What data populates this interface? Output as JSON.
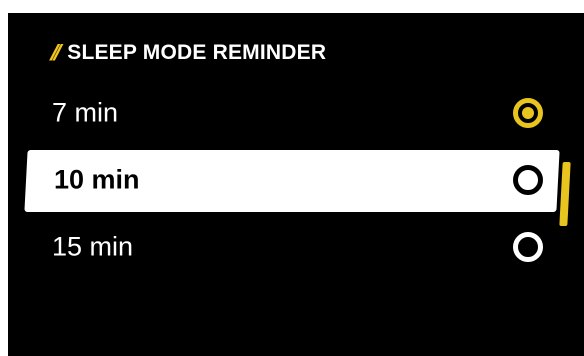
{
  "header": {
    "slashes": "//",
    "title": "SLEEP MODE REMINDER"
  },
  "options": [
    {
      "label": "7 min",
      "selected": true,
      "focused": false
    },
    {
      "label": "10 min",
      "selected": false,
      "focused": true
    },
    {
      "label": "15 min",
      "selected": false,
      "focused": false
    }
  ],
  "colors": {
    "background": "#000000",
    "accent": "#e8c41e",
    "text": "#ffffff",
    "focus_card": "#ffffff"
  },
  "icons": {
    "radio_checked": "radio-checked-icon",
    "radio_unchecked": "radio-unchecked-icon"
  }
}
